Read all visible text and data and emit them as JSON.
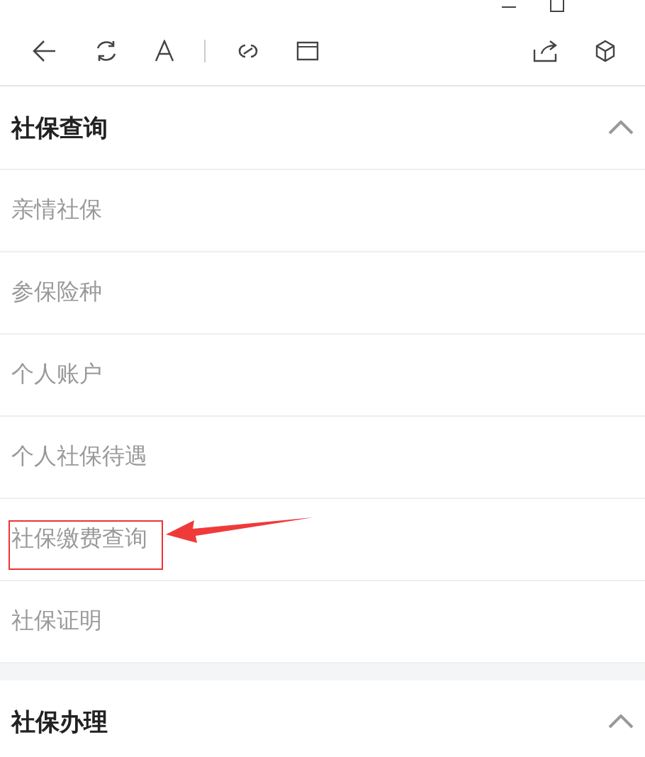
{
  "sections": [
    {
      "title": "社保查询",
      "expanded": true,
      "items": [
        {
          "label": "亲情社保",
          "highlighted": false
        },
        {
          "label": "参保险种",
          "highlighted": false
        },
        {
          "label": "个人账户",
          "highlighted": false
        },
        {
          "label": "个人社保待遇",
          "highlighted": false
        },
        {
          "label": "社保缴费查询",
          "highlighted": true
        },
        {
          "label": "社保证明",
          "highlighted": false
        }
      ]
    },
    {
      "title": "社保办理",
      "expanded": true
    }
  ]
}
